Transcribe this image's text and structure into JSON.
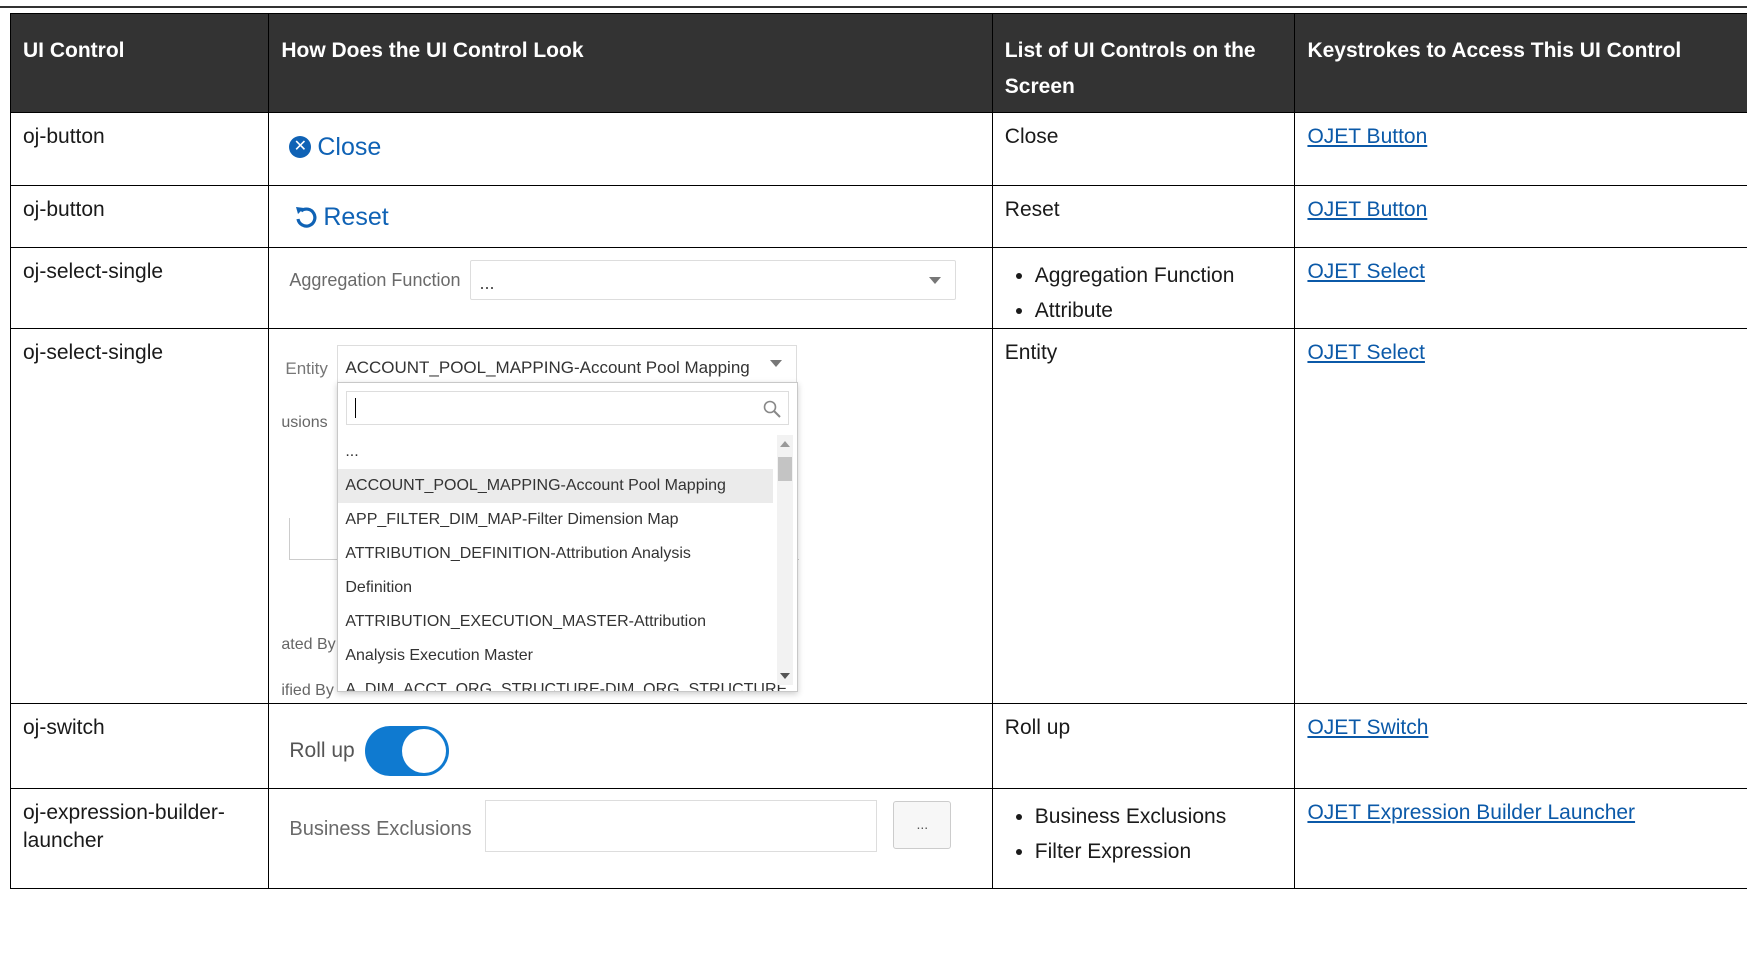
{
  "headers": [
    "UI Control",
    "How Does the UI Control Look",
    "List of UI Controls on the Screen",
    "Keystrokes to Access This UI Control"
  ],
  "rows": [
    {
      "control": "oj-button",
      "mock": {
        "icon": "close-circle-icon",
        "label": "Close"
      },
      "list": [
        "Close"
      ],
      "link": "OJET Button"
    },
    {
      "control": "oj-button",
      "mock": {
        "icon": "reset-icon",
        "label": "Reset"
      },
      "list": [
        "Reset"
      ],
      "link": "OJET Button"
    },
    {
      "control": "oj-select-single",
      "mock": {
        "label": "Aggregation Function",
        "value": "..."
      },
      "list": [
        "Aggregation Function",
        "Attribute"
      ],
      "link": "OJET Select"
    },
    {
      "control": "oj-select-single",
      "mock": {
        "label": "Entity",
        "value": "ACCOUNT_POOL_MAPPING-Account Pool Mapping",
        "ghost_labels": [
          "usions",
          "ated By",
          "ified By"
        ],
        "options": [
          "...",
          "ACCOUNT_POOL_MAPPING-Account Pool Mapping",
          "APP_FILTER_DIM_MAP-Filter Dimension Map",
          "ATTRIBUTION_DEFINITION-Attribution Analysis",
          "Definition",
          "ATTRIBUTION_EXECUTION_MASTER-Attribution",
          "Analysis Execution Master",
          "A_DIM_ACCT_ORG_STRUCTURE-DIM_ORG_STRUCTURE"
        ],
        "selected_index": 1
      },
      "list": [
        "Entity"
      ],
      "link": "OJET Select"
    },
    {
      "control": "oj-switch",
      "mock": {
        "label": "Roll up",
        "state": "on"
      },
      "list": [
        "Roll up"
      ],
      "link": "OJET Switch"
    },
    {
      "control": "oj-expression-builder-launcher",
      "mock": {
        "label": "Business Exclusions",
        "button": "..."
      },
      "list": [
        "Business Exclusions",
        "Filter Expression"
      ],
      "link": "OJET Expression Builder Launcher"
    }
  ],
  "colors": {
    "header_bg": "#333333",
    "link": "#0b59a8",
    "accent": "#0f7ad0"
  }
}
